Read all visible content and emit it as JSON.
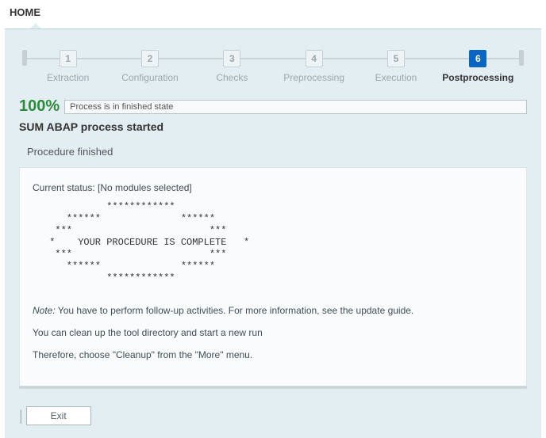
{
  "header": {
    "home_label": "HOME"
  },
  "steps": [
    {
      "num": "1",
      "label": "Extraction"
    },
    {
      "num": "2",
      "label": "Configuration"
    },
    {
      "num": "3",
      "label": "Checks"
    },
    {
      "num": "4",
      "label": "Preprocessing"
    },
    {
      "num": "5",
      "label": "Execution"
    },
    {
      "num": "6",
      "label": "Postprocessing"
    }
  ],
  "status": {
    "percent": "100%",
    "state_text": "Process is in finished state",
    "proc_line": "SUM ABAP process started",
    "sub_line": "Procedure finished"
  },
  "content": {
    "current_status": "Current status: [No modules selected]",
    "ascii": "           ************\n    ******              ******\n  ***                        ***\n *    YOUR PROCEDURE IS COMPLETE   *\n  ***                        ***\n    ******              ******\n           ************",
    "note_prefix": "Note:",
    "note_text": " You have to perform follow-up activities. For more information, see the update guide.",
    "cleanup1": "You can clean up the tool directory and start a new run",
    "cleanup2": "Therefore, choose \"Cleanup\" from the \"More\" menu."
  },
  "footer": {
    "exit_label": "Exit"
  }
}
